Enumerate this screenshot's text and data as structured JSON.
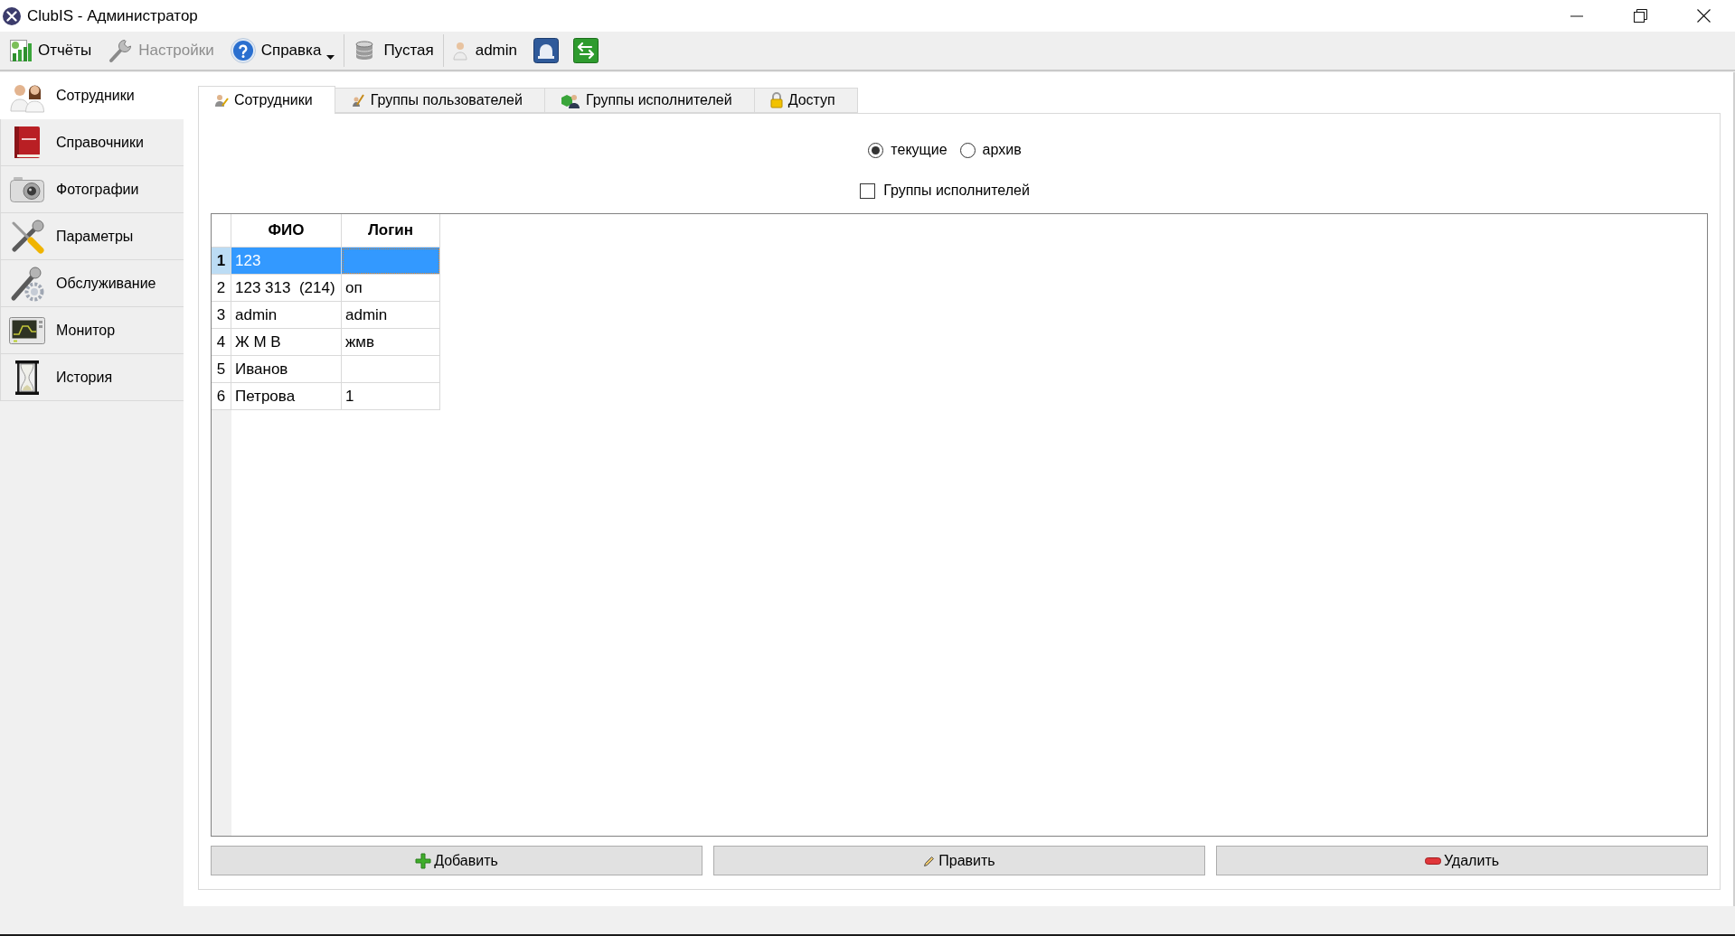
{
  "window": {
    "title": "ClubIS - Администратор"
  },
  "toolbar": {
    "groups": [
      [
        {
          "kind": "button",
          "label": "Отчёты",
          "disabled": false
        },
        {
          "kind": "button",
          "label": "Настройки",
          "disabled": true
        },
        {
          "kind": "dropdown",
          "label": "Справка",
          "disabled": false
        }
      ],
      [
        {
          "kind": "label",
          "label": "Пустая",
          "disabled": false
        }
      ],
      [
        {
          "kind": "label",
          "label": "admin",
          "disabled": false
        }
      ]
    ]
  },
  "sidebar": {
    "items": [
      {
        "label": "Сотрудники",
        "selected": true
      },
      {
        "label": "Справочники",
        "selected": false
      },
      {
        "label": "Фотографии",
        "selected": false
      },
      {
        "label": "Параметры",
        "selected": false
      },
      {
        "label": "Обслуживание",
        "selected": false
      },
      {
        "label": "Монитор",
        "selected": false
      },
      {
        "label": "История",
        "selected": false
      }
    ]
  },
  "tabs": [
    {
      "label": "Сотрудники",
      "selected": true
    },
    {
      "label": "Группы пользователей",
      "selected": false
    },
    {
      "label": "Группы исполнителей",
      "selected": false
    },
    {
      "label": "Доступ",
      "selected": false
    }
  ],
  "filter": {
    "radios": [
      {
        "label": "текущие",
        "selected": true
      },
      {
        "label": "архив",
        "selected": false
      }
    ],
    "checkbox": {
      "label": "Группы исполнителей",
      "checked": false
    }
  },
  "table": {
    "columns": [
      "ФИО",
      "Логин"
    ],
    "rows": [
      {
        "number": "1",
        "cells": [
          "123"
        ],
        "selected": true
      },
      {
        "number": "2",
        "cells": [
          "123 313  (214)",
          "оп"
        ],
        "selected": false
      },
      {
        "number": "3",
        "cells": [
          "admin",
          "admin"
        ],
        "selected": false
      },
      {
        "number": "4",
        "cells": [
          "Ж М В",
          "жмв"
        ],
        "selected": false
      },
      {
        "number": "5",
        "cells": [
          "Иванов"
        ],
        "selected": false
      },
      {
        "number": "6",
        "cells": [
          "Петрова",
          "1"
        ],
        "selected": false
      }
    ]
  },
  "buttons": [
    {
      "label": "Добавить"
    },
    {
      "label": "Править"
    },
    {
      "label": "Удалить"
    }
  ]
}
